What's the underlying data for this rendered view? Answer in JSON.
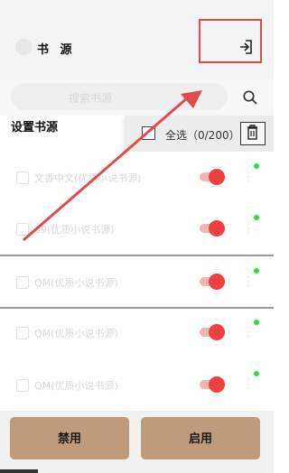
{
  "header": {
    "title": "书 源",
    "import_icon": "import-icon"
  },
  "search": {
    "placeholder": "搜索书源",
    "icon": "search-icon"
  },
  "group": {
    "name": "设置书源"
  },
  "select_all": {
    "label": "全选（0/200）",
    "delete_icon": "delete-icon"
  },
  "sources": [
    {
      "name": "文香中文(优质小说书源)",
      "enabled": true
    },
    {
      "name": "69(优质小说书源)",
      "enabled": true
    },
    {
      "name": "QM(优质小说书源)",
      "enabled": true
    },
    {
      "name": "QM(优质小说书源)",
      "enabled": true
    },
    {
      "name": "QM(优质小说书源)",
      "enabled": true
    }
  ],
  "buttons": {
    "disable": "禁用",
    "enable": "启用"
  },
  "colors": {
    "accent": "#ef4040",
    "button": "#bf9b7b",
    "highlight": "#e04b4b",
    "status": "#2ee02e"
  }
}
